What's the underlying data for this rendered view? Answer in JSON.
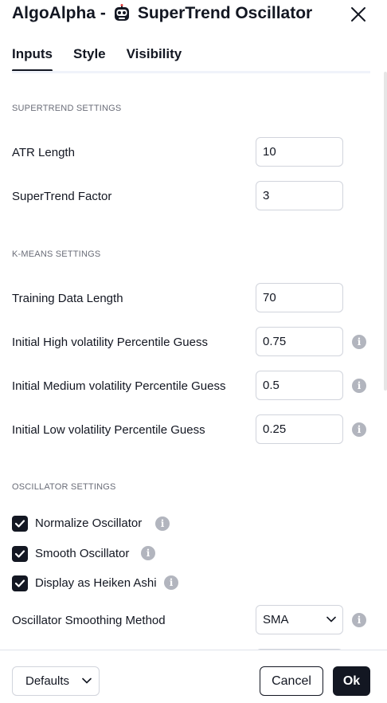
{
  "dialog": {
    "title_prefix": "AlgoAlpha -",
    "title_main": "SuperTrend Oscillator"
  },
  "tabs": [
    {
      "label": "Inputs",
      "active": true
    },
    {
      "label": "Style",
      "active": false
    },
    {
      "label": "Visibility",
      "active": false
    }
  ],
  "sections": {
    "supertrend": "SUPERTREND SETTINGS",
    "kmeans": "K-MEANS SETTINGS",
    "oscillator": "OSCILLATOR SETTINGS"
  },
  "fields": {
    "atr_length": {
      "label": "ATR Length",
      "value": "10"
    },
    "supertrend_factor": {
      "label": "SuperTrend Factor",
      "value": "3"
    },
    "training_length": {
      "label": "Training Data Length",
      "value": "70"
    },
    "high_vol": {
      "label": "Initial High volatility Percentile Guess",
      "value": "0.75"
    },
    "medium_vol": {
      "label": "Initial Medium volatility Percentile Guess",
      "value": "0.5"
    },
    "low_vol": {
      "label": "Initial Low volatility Percentile Guess",
      "value": "0.25"
    }
  },
  "checkboxes": {
    "normalize": {
      "label": "Normalize Oscillator",
      "checked": true
    },
    "smooth": {
      "label": "Smooth Oscillator",
      "checked": true
    },
    "heiken": {
      "label": "Display as Heiken Ashi",
      "checked": true
    }
  },
  "smoothing_method": {
    "label": "Oscillator Smoothing Method",
    "selected": "SMA"
  },
  "info_glyph": "i",
  "footer": {
    "defaults_label": "Defaults",
    "cancel_label": "Cancel",
    "ok_label": "Ok"
  },
  "colors": {
    "text": "#131722",
    "accent_dark": "#131722",
    "info_icon": "#b2b5be",
    "border": "#d1d4dc",
    "section_text": "#6a6d78"
  }
}
